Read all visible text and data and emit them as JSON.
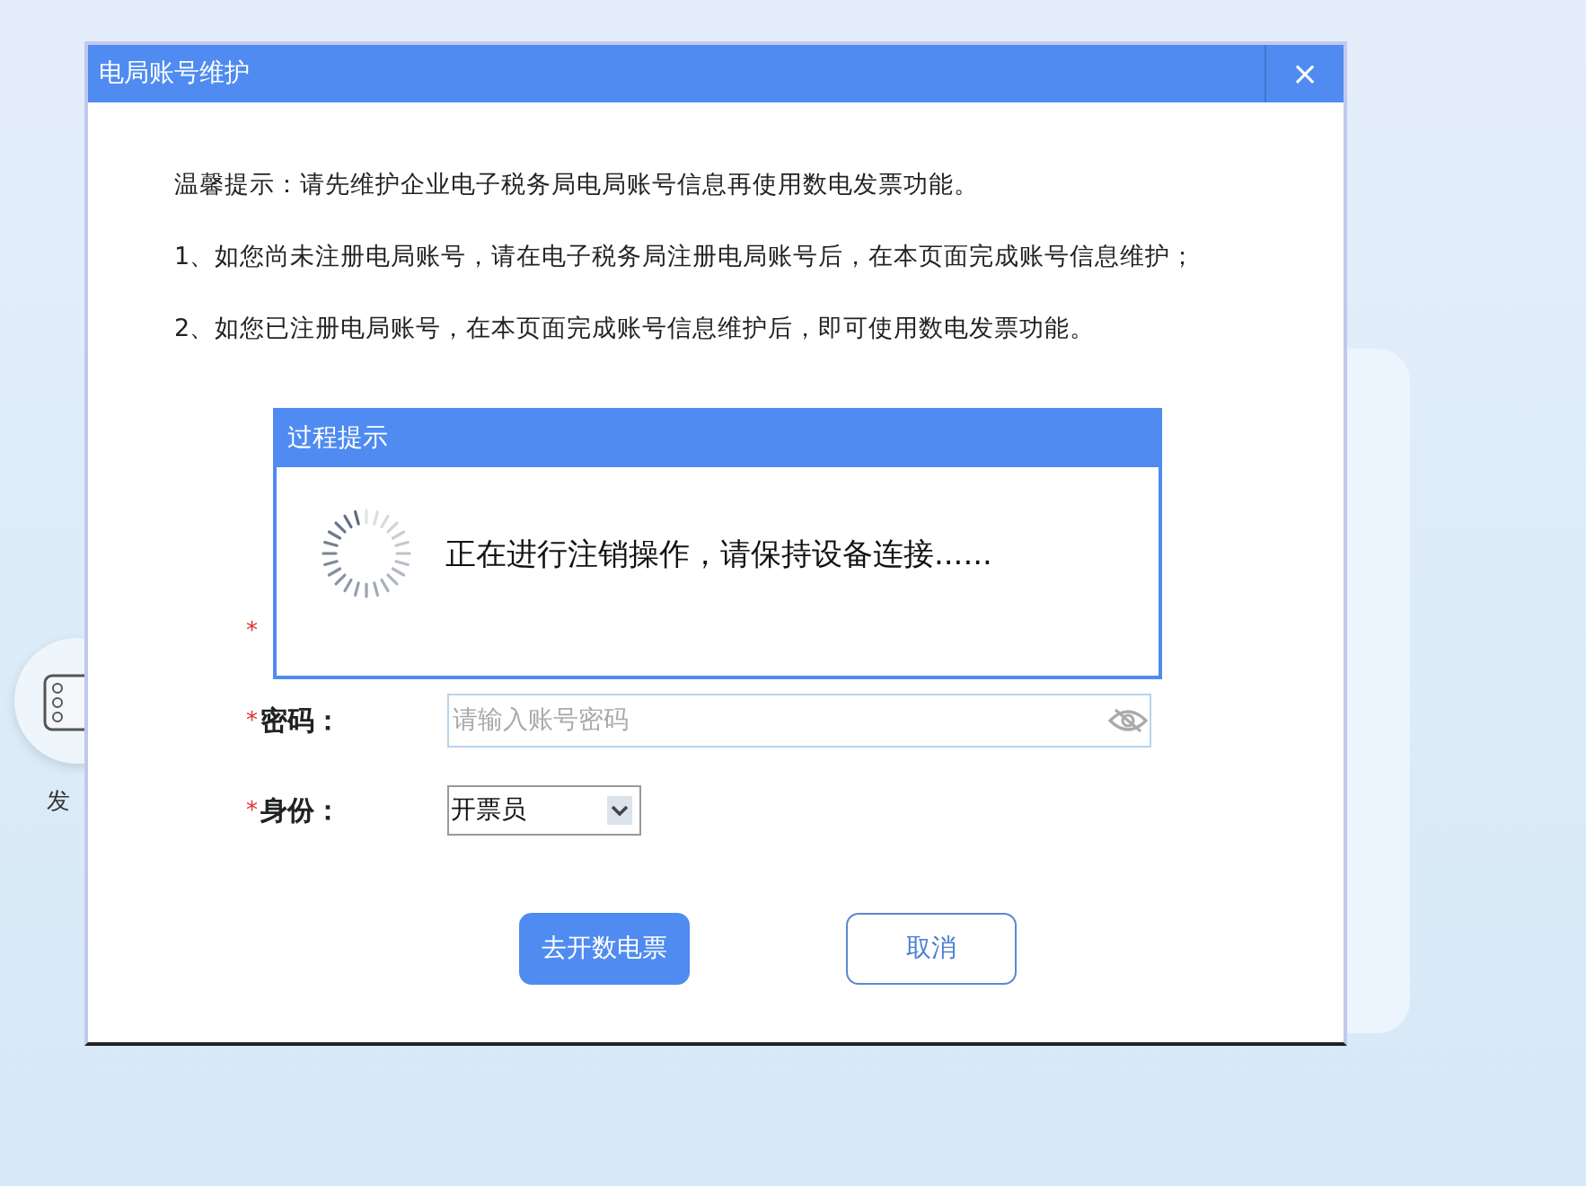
{
  "window": {
    "title": "电局账号维护",
    "close": "×"
  },
  "notice": [
    "温馨提示：请先维护企业电子税务局电局账号信息再使用数电发票功能。",
    "1、如您尚未注册电局账号，请在电子税务局注册电局账号后，在本页面完成账号信息维护；",
    "2、如您已注册电局账号，在本页面完成账号信息维护后，即可使用数电发票功能。"
  ],
  "form": {
    "hidden_rows": [
      {
        "mark": "*"
      }
    ],
    "fields": [
      {
        "kind": "password",
        "mark": "*",
        "label": "密码：",
        "placeholder": "请输入账号密码"
      },
      {
        "kind": "select",
        "mark": "*",
        "label": "身份：",
        "value": "开票员"
      }
    ]
  },
  "buttons": [
    {
      "label": "去开数电票",
      "primary": true
    },
    {
      "label": "取消",
      "primary": false
    }
  ],
  "progress_dialog": {
    "title": "过程提示",
    "message": "正在进行注销操作，请保持设备连接......"
  },
  "background": {
    "app_label": "发"
  }
}
